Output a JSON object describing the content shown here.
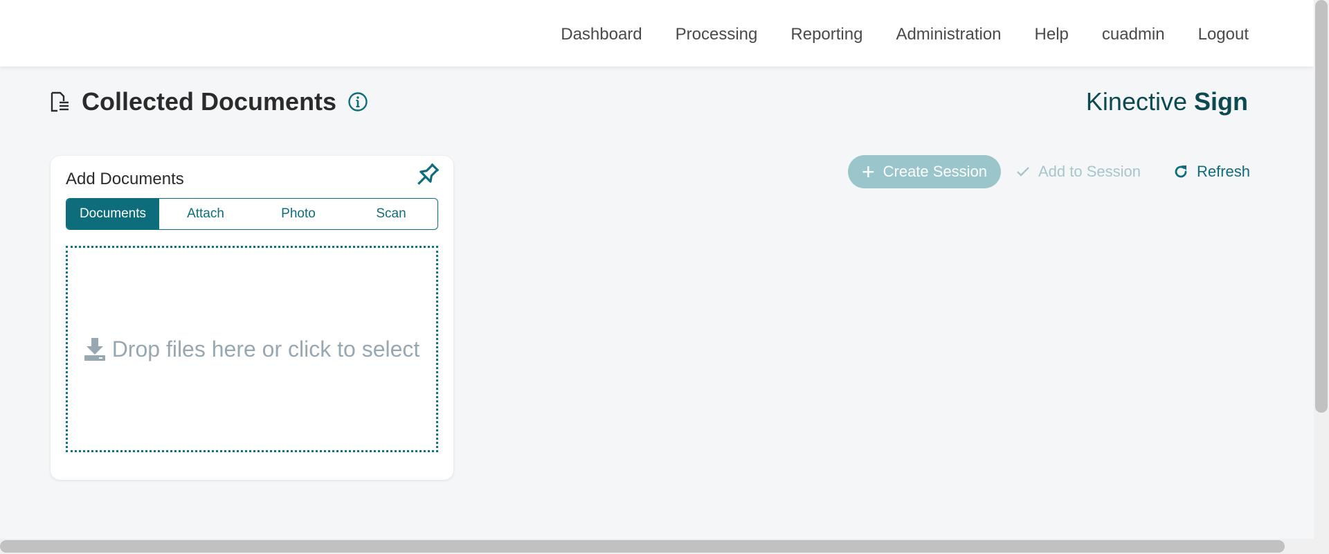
{
  "nav": {
    "items": [
      "Dashboard",
      "Processing",
      "Reporting",
      "Administration",
      "Help",
      "cuadmin",
      "Logout"
    ]
  },
  "header": {
    "title": "Collected Documents",
    "title_icon": "document-list-icon",
    "info_icon": "info-circle-icon",
    "brand_light": "Kinective ",
    "brand_bold": "Sign"
  },
  "add_documents": {
    "title": "Add Documents",
    "pin_icon": "pushpin-icon",
    "tabs": [
      {
        "label": "Documents",
        "active": true
      },
      {
        "label": "Attach",
        "active": false
      },
      {
        "label": "Photo",
        "active": false
      },
      {
        "label": "Scan",
        "active": false
      }
    ],
    "dropzone_icon": "download-icon",
    "dropzone_text": "Drop files here or click to select"
  },
  "actions": {
    "create_session": "Create Session",
    "add_to_session": "Add to Session",
    "refresh": "Refresh"
  },
  "colors": {
    "accent": "#0e6d7b",
    "accent_light": "#9ac5cb",
    "brand": "#0d4950",
    "background": "#f5f6f8"
  }
}
